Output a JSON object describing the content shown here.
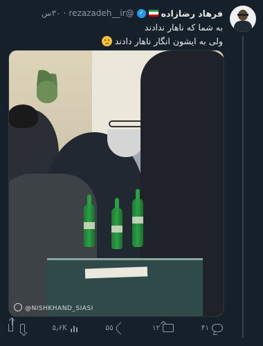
{
  "tweet": {
    "author_name": "فرهاد رضازاده",
    "handle": "@rezazadeh__ir",
    "time": "۳۰س",
    "line1": "به شما که ناهار ندادند",
    "line2": "ولی به ایشون انگار ناهار دادند",
    "emoji": "confused-face-emoji"
  },
  "photo": {
    "watermark": "@NISHKHAND_SIASI"
  },
  "actions": {
    "reply_count": "۴۱",
    "retweet_count": "۱۲",
    "like_count": "۵۵",
    "view_count": "۵٫۶K"
  },
  "colors": {
    "background": "#15202b",
    "text": "#e7e9ea",
    "muted": "#8b98a5",
    "verified": "#1d9bf0",
    "flag_green": "#239f40",
    "flag_white": "#ffffff",
    "flag_red": "#da0000"
  }
}
